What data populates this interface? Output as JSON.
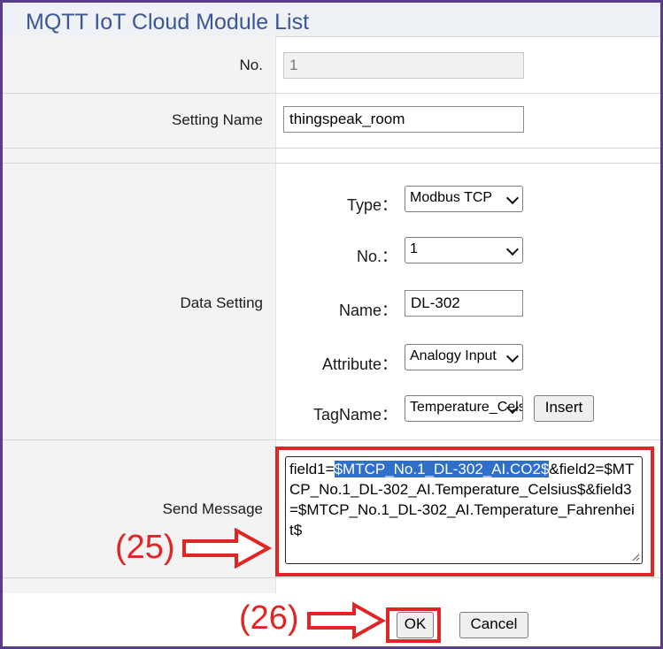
{
  "window": {
    "title": "MQTT IoT Cloud Module List"
  },
  "form": {
    "no_label": "No.",
    "no_value": "1",
    "setting_name_label": "Setting Name",
    "setting_name_value": "thingspeak_room",
    "data_setting_label": "Data Setting",
    "send_message_label": "Send Message"
  },
  "data_setting": {
    "type_label": "Type：",
    "type_value": "Modbus TCP",
    "no_label": "No.：",
    "no_value": "1",
    "name_label": "Name：",
    "name_value": "DL-302",
    "attribute_label": "Attribute：",
    "attribute_value": "Analogy Input",
    "tagname_label": "TagName：",
    "tagname_value": "Temperature_Celsius",
    "insert_label": "Insert"
  },
  "message": {
    "prefix": "field1=",
    "highlighted": "$MTCP_No.1_DL-302_AI.CO2$",
    "rest": "&field2=$MTCP_No.1_DL-302_AI.Temperature_Celsius$&field3=$MTCP_No.1_DL-302_AI.Temperature_Fahrenheit$"
  },
  "buttons": {
    "ok_label": "OK",
    "cancel_label": "Cancel"
  },
  "annotations": {
    "step_25": "(25)",
    "step_26": "(26)"
  },
  "colors": {
    "accent": "#3a5795",
    "annotation_red": "#e02525",
    "selection": "#2f6fcc",
    "frame": "#5a3d8a"
  }
}
